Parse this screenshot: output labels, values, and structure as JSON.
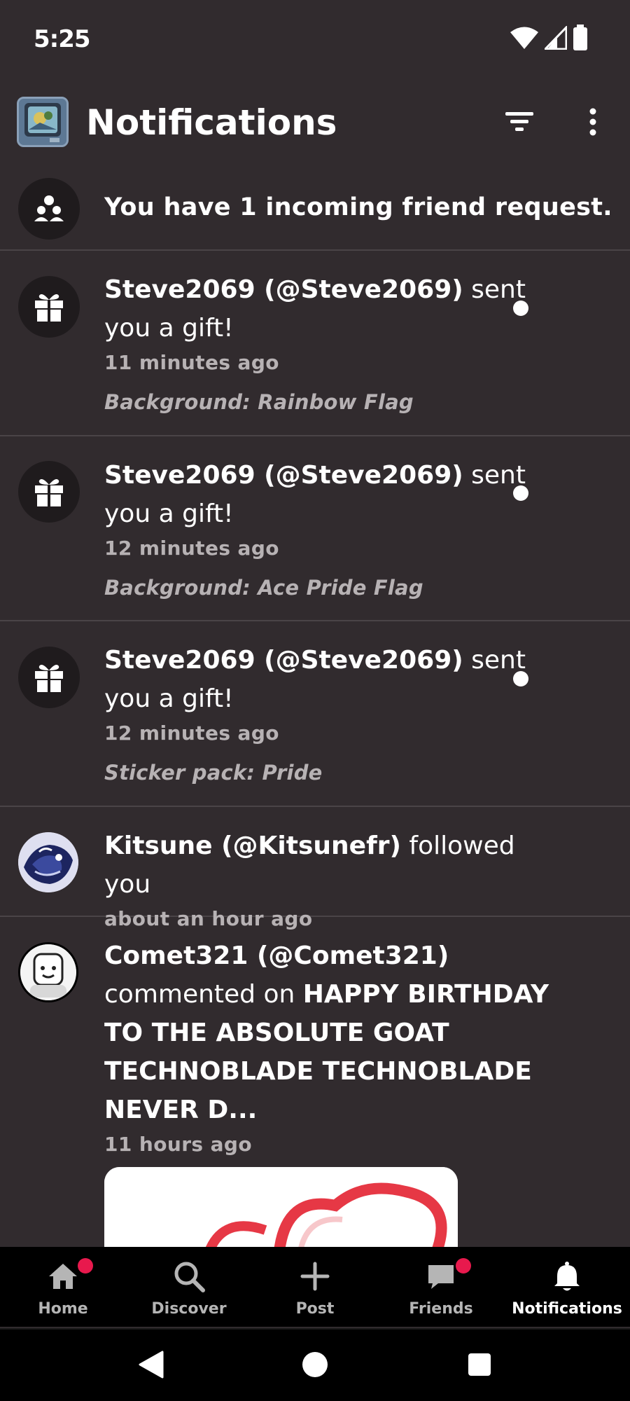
{
  "status_bar": {
    "time": "5:25",
    "icons": [
      "wifi-icon",
      "signal-icon",
      "battery-icon"
    ]
  },
  "header": {
    "title": "Notifications",
    "icons": [
      "app-logo",
      "filter-icon",
      "more-vert-icon"
    ]
  },
  "friend_request": {
    "text": "You have 1 incoming friend request.",
    "icon": "people-icon"
  },
  "notifications": [
    {
      "user": "Steve2069 (@Steve2069)",
      "action": " sent you a gift!",
      "time": "11 minutes ago",
      "detail": "Background: Rainbow Flag",
      "icon": "gift-icon",
      "unread": true
    },
    {
      "user": "Steve2069 (@Steve2069)",
      "action": " sent you a gift!",
      "time": "12 minutes ago",
      "detail": "Background: Ace Pride Flag",
      "icon": "gift-icon",
      "unread": true
    },
    {
      "user": "Steve2069 (@Steve2069)",
      "action": " sent you a gift!",
      "time": "12 minutes ago",
      "detail": "Sticker pack: Pride",
      "icon": "gift-icon",
      "unread": true
    },
    {
      "user": "Kitsune (@Kitsunefr)",
      "action": " followed you",
      "time": "about an hour ago",
      "icon": "avatar"
    },
    {
      "user": "Comet321 (@Comet321)",
      "action": "commented on ",
      "target": "HAPPY BIRTHDAY TO THE ABSOLUTE GOAT TECHNOBLADE TECHNOBLADE NEVER D...",
      "time": "11 hours ago",
      "icon": "avatar"
    }
  ],
  "bottom_nav": {
    "items": [
      {
        "label": "Home",
        "icon": "home-icon",
        "badge": true
      },
      {
        "label": "Discover",
        "icon": "search-icon",
        "badge": false
      },
      {
        "label": "Post",
        "icon": "plus-icon",
        "badge": false
      },
      {
        "label": "Friends",
        "icon": "chat-icon",
        "badge": true
      },
      {
        "label": "Notifications",
        "icon": "bell-icon",
        "badge": false,
        "active": true
      }
    ]
  },
  "colors": {
    "background": "#312b2e",
    "divider": "#4a4447",
    "badge": "#e8194d",
    "secondary_text": "#b7b2b4"
  }
}
